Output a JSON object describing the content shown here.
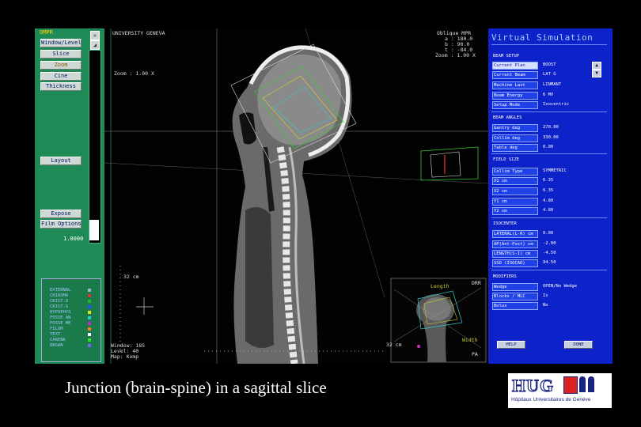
{
  "left_panel": {
    "title": "OMPR",
    "buttons": [
      {
        "label": "Window/Level",
        "active": false
      },
      {
        "label": "Slice",
        "active": false
      },
      {
        "label": "Zoom",
        "active": true
      },
      {
        "label": "Cine",
        "active": false
      },
      {
        "label": "Thickness",
        "active": false
      },
      {
        "label": "Layout",
        "active": false
      },
      {
        "label": "Expose",
        "active": false
      },
      {
        "label": "Film Options",
        "active": false
      }
    ],
    "zoom_value": "1.0000",
    "structures": [
      {
        "name": "EXTERNAL",
        "color": "#9ab0d0"
      },
      {
        "name": "CHIASMA",
        "color": "#e03030"
      },
      {
        "name": "CRIST.D",
        "color": "#20c020"
      },
      {
        "name": "CRIST.G",
        "color": "#3050ff"
      },
      {
        "name": "HYPOPHYS",
        "color": "#e0e020"
      },
      {
        "name": "FOSSE AN",
        "color": "#20d0d0"
      },
      {
        "name": "FOSSE ME",
        "color": "#d020d0"
      },
      {
        "name": "FILUM",
        "color": "#ff8020"
      },
      {
        "name": "TEXT",
        "color": "#ffffff"
      },
      {
        "name": "CARENA",
        "color": "#30e030"
      },
      {
        "name": "ORGAN",
        "color": "#8060ff"
      }
    ]
  },
  "viewer": {
    "header_left": "UNIVERSITY GENEVA",
    "zoom_text": "Zoom : 1.00 X",
    "oblique_title": "Oblique MPR",
    "oblique_lines": [
      "a : 180.0",
      "b : 90.0",
      "t : -84.0",
      "Zoom : 1.00 X"
    ],
    "scale_vertical": "32 cm",
    "scale_horizontal": "32 cm",
    "window_lines": [
      "Window: 185",
      "Level: 40",
      "Map: Komp"
    ],
    "drr_label": "DRR",
    "length_label": "Length",
    "width_label": "Width",
    "pa_label": "PA"
  },
  "right_panel": {
    "title": "Virtual Simulation",
    "sections": [
      {
        "title": "BEAM SETUP",
        "rows": [
          {
            "label": "Current Plan",
            "value": "BOOST",
            "highlight": true
          },
          {
            "label": "Current Beam",
            "value": "LAT G",
            "highlight": false
          },
          {
            "label": "Machine Last",
            "value": "LINMANT",
            "highlight": false
          },
          {
            "label": "Beam Energy",
            "value": "6 MV",
            "highlight": false
          },
          {
            "label": "Setup Mode",
            "value": "Isocentric",
            "highlight": false
          }
        ]
      },
      {
        "title": "BEAM ANGLES",
        "rows": [
          {
            "label": "Gantry   deg",
            "value": "270.00"
          },
          {
            "label": "Collim   deg",
            "value": "330.00"
          },
          {
            "label": "Table    deg",
            "value": "0.00"
          }
        ]
      },
      {
        "title": "FIELD SIZE",
        "rows": [
          {
            "label": "Collim Type",
            "value": "SYMMETRIC"
          },
          {
            "label": "X1 cm",
            "value": "6.35"
          },
          {
            "label": "X2 cm",
            "value": "6.35"
          },
          {
            "label": "Y1 cm",
            "value": "4.80"
          },
          {
            "label": "Y2 cm",
            "value": "4.80"
          }
        ]
      },
      {
        "title": "ISOCENTER",
        "rows": [
          {
            "label": "LATERAL(L-R) cm",
            "value": "0.00"
          },
          {
            "label": "AP(Ant-Post) cm",
            "value": "-2.00"
          },
          {
            "label": "LENGTH(S-I) cm",
            "value": "-4.50"
          },
          {
            "label": "SSD (ISOCAD)",
            "value": "94.50"
          }
        ]
      },
      {
        "title": "MODIFIERS",
        "rows": [
          {
            "label": "Wedge",
            "value": "OPEN/No Wedge"
          },
          {
            "label": "Blocks / MLC",
            "value": "Is"
          },
          {
            "label": "Bolus",
            "value": "No"
          }
        ]
      }
    ],
    "help_label": "HELP",
    "done_label": "DONE"
  },
  "caption": "Junction (brain-spine) in a sagittal slice",
  "logo": {
    "text": "HUG",
    "subtitle": "Hôpitaux Universitaires de Genève"
  }
}
